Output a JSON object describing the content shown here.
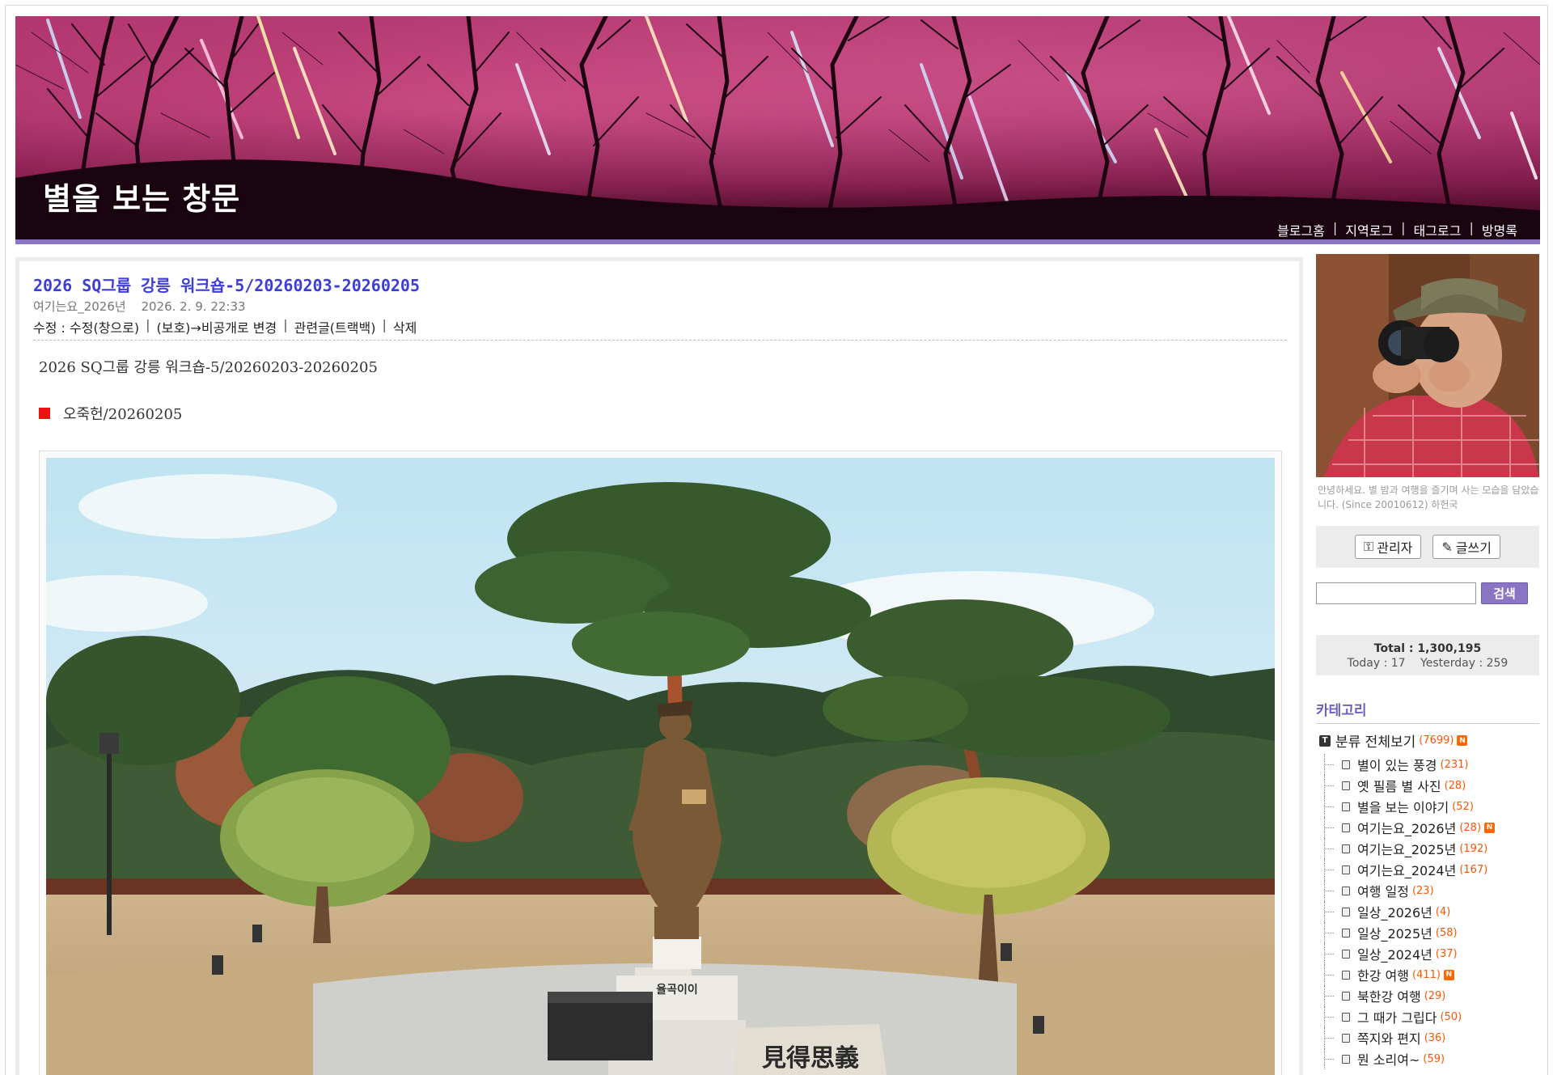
{
  "header": {
    "blog_title": "별을 보는 창문",
    "nav": [
      "블로그홈",
      "지역로그",
      "태그로그",
      "방명록"
    ]
  },
  "post": {
    "title": "2026 SQ그룹 강릉 워크숍-5/20260203-20260205",
    "category": "여기는요_2026년",
    "date": "2026. 2. 9. 22:33",
    "actions": {
      "label": "수정 :",
      "edit_window": "수정(창으로)",
      "visibility": "(보호)→비공개로 변경",
      "related": "관련글(트랙백)",
      "delete": "삭제"
    },
    "body_heading": "2026 SQ그룹 강릉 워크숍-5/20260203-20260205",
    "subheading": "오죽헌/20260205",
    "photo_texts": {
      "pedestal": "율곡이이",
      "stone": "見得思義"
    }
  },
  "sidebar": {
    "profile_caption": "안녕하세요. 별 밤과 여행을 즐기며 사는 모습을 담았습니다. (Since 20010612) 하헌국",
    "admin_label": "관리자",
    "write_label": "글쓰기",
    "search_button": "검색",
    "search_placeholder": "",
    "counter": {
      "total": "Total : 1,300,195",
      "today": "Today : 17",
      "yesterday": "Yesterday : 259"
    },
    "category_title": "카테고리",
    "root": {
      "label": "분류 전체보기",
      "count": "(7699)",
      "is_new": true
    },
    "categories": [
      {
        "label": "별이 있는 풍경",
        "count": "(231)",
        "is_new": false
      },
      {
        "label": "옛 필름 별 사진",
        "count": "(28)",
        "is_new": false
      },
      {
        "label": "별을 보는 이야기",
        "count": "(52)",
        "is_new": false
      },
      {
        "label": "여기는요_2026년",
        "count": "(28)",
        "is_new": true
      },
      {
        "label": "여기는요_2025년",
        "count": "(192)",
        "is_new": false
      },
      {
        "label": "여기는요_2024년",
        "count": "(167)",
        "is_new": false
      },
      {
        "label": "여행 일정",
        "count": "(23)",
        "is_new": false
      },
      {
        "label": "일상_2026년",
        "count": "(4)",
        "is_new": false
      },
      {
        "label": "일상_2025년",
        "count": "(58)",
        "is_new": false
      },
      {
        "label": "일상_2024년",
        "count": "(37)",
        "is_new": false
      },
      {
        "label": "한강 여행",
        "count": "(411)",
        "is_new": true
      },
      {
        "label": "북한강 여행",
        "count": "(29)",
        "is_new": false
      },
      {
        "label": "그 때가 그립다",
        "count": "(50)",
        "is_new": false
      },
      {
        "label": "쪽지와 편지",
        "count": "(36)",
        "is_new": false
      },
      {
        "label": "뭔 소리여~",
        "count": "(59)",
        "is_new": false
      }
    ],
    "new_badge": "N",
    "root_icon": "T"
  }
}
